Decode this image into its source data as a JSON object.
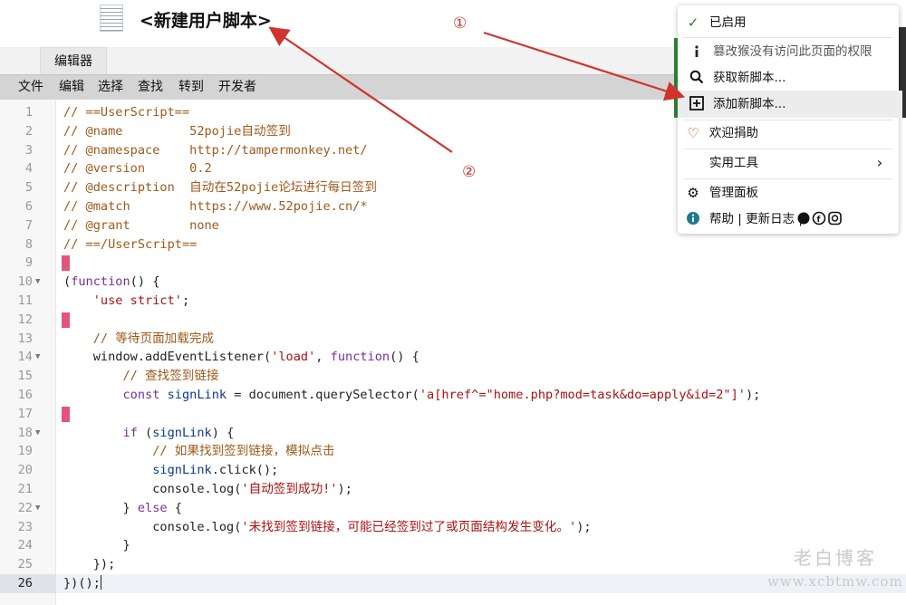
{
  "header": {
    "title": "<新建用户脚本>"
  },
  "tabs": [
    {
      "label": "编辑器"
    }
  ],
  "menu": [
    "文件",
    "编辑",
    "选择",
    "查找",
    "转到",
    "开发者"
  ],
  "editor_lines": [
    {
      "n": "1",
      "tokens": [
        {
          "t": "// ==UserScript==",
          "c": "cm"
        }
      ]
    },
    {
      "n": "2",
      "tokens": [
        {
          "t": "// @name         52pojie自动签到",
          "c": "cm"
        }
      ]
    },
    {
      "n": "3",
      "tokens": [
        {
          "t": "// @namespace    http://tampermonkey.net/",
          "c": "cm"
        }
      ]
    },
    {
      "n": "4",
      "tokens": [
        {
          "t": "// @version      0.2",
          "c": "cm"
        }
      ]
    },
    {
      "n": "5",
      "tokens": [
        {
          "t": "// @description  自动在52pojie论坛进行每日签到",
          "c": "cm"
        }
      ]
    },
    {
      "n": "6",
      "tokens": [
        {
          "t": "// @match        https://www.52pojie.cn/*",
          "c": "cm"
        }
      ]
    },
    {
      "n": "7",
      "tokens": [
        {
          "t": "// @grant        none",
          "c": "cm"
        }
      ]
    },
    {
      "n": "8",
      "tokens": [
        {
          "t": "// ==/UserScript==",
          "c": "cm"
        }
      ]
    },
    {
      "n": "9",
      "marker": true,
      "tokens": []
    },
    {
      "n": "10",
      "fold": true,
      "tokens": [
        {
          "t": "(",
          "c": ""
        },
        {
          "t": "function",
          "c": "kw"
        },
        {
          "t": "() {",
          "c": ""
        }
      ]
    },
    {
      "n": "11",
      "tokens": [
        {
          "t": "    ",
          "c": ""
        },
        {
          "t": "'use strict'",
          "c": "str"
        },
        {
          "t": ";",
          "c": ""
        }
      ]
    },
    {
      "n": "12",
      "marker": true,
      "tokens": []
    },
    {
      "n": "13",
      "tokens": [
        {
          "t": "    // 等待页面加载完成",
          "c": "cm"
        }
      ]
    },
    {
      "n": "14",
      "fold": true,
      "tokens": [
        {
          "t": "    window.addEventListener(",
          "c": ""
        },
        {
          "t": "'load'",
          "c": "str"
        },
        {
          "t": ", ",
          "c": ""
        },
        {
          "t": "function",
          "c": "kw"
        },
        {
          "t": "() {",
          "c": ""
        }
      ]
    },
    {
      "n": "15",
      "tokens": [
        {
          "t": "        // 查找签到链接",
          "c": "cm"
        }
      ]
    },
    {
      "n": "16",
      "tokens": [
        {
          "t": "        ",
          "c": ""
        },
        {
          "t": "const",
          "c": "kw"
        },
        {
          "t": " ",
          "c": ""
        },
        {
          "t": "signLink",
          "c": "var"
        },
        {
          "t": " = document.querySelector(",
          "c": ""
        },
        {
          "t": "'a[href^=\"home.php?mod=task&do=apply&id=2\"]'",
          "c": "str"
        },
        {
          "t": ");",
          "c": ""
        }
      ]
    },
    {
      "n": "17",
      "marker": true,
      "tokens": []
    },
    {
      "n": "18",
      "fold": true,
      "tokens": [
        {
          "t": "        ",
          "c": ""
        },
        {
          "t": "if",
          "c": "kw"
        },
        {
          "t": " (",
          "c": ""
        },
        {
          "t": "signLink",
          "c": "var"
        },
        {
          "t": ") {",
          "c": ""
        }
      ]
    },
    {
      "n": "19",
      "tokens": [
        {
          "t": "            // 如果找到签到链接，模拟点击",
          "c": "cm"
        }
      ]
    },
    {
      "n": "20",
      "tokens": [
        {
          "t": "            ",
          "c": ""
        },
        {
          "t": "signLink",
          "c": "var"
        },
        {
          "t": ".click();",
          "c": ""
        }
      ]
    },
    {
      "n": "21",
      "tokens": [
        {
          "t": "            console.log(",
          "c": ""
        },
        {
          "t": "'自动签到成功!'",
          "c": "str"
        },
        {
          "t": ");",
          "c": ""
        }
      ]
    },
    {
      "n": "22",
      "fold": true,
      "tokens": [
        {
          "t": "        } ",
          "c": ""
        },
        {
          "t": "else",
          "c": "kw"
        },
        {
          "t": " {",
          "c": ""
        }
      ]
    },
    {
      "n": "23",
      "tokens": [
        {
          "t": "            console.log(",
          "c": ""
        },
        {
          "t": "'未找到签到链接，可能已经签到过了或页面结构发生变化。'",
          "c": "str"
        },
        {
          "t": ");",
          "c": ""
        }
      ]
    },
    {
      "n": "24",
      "tokens": [
        {
          "t": "        }",
          "c": ""
        }
      ]
    },
    {
      "n": "25",
      "tokens": [
        {
          "t": "    });",
          "c": ""
        }
      ]
    },
    {
      "n": "26",
      "active": true,
      "tokens": [
        {
          "t": "})();",
          "c": ""
        }
      ]
    }
  ],
  "popup": {
    "enabled": {
      "label": "已启用",
      "icon": "check-icon"
    },
    "permission": {
      "label": "篡改猴没有访问此页面的权限",
      "icon": "info-icon"
    },
    "get_new": {
      "label": "获取新脚本...",
      "icon": "search-icon"
    },
    "add_new": {
      "label": "添加新脚本...",
      "icon": "plus-box-icon"
    },
    "donate": {
      "label": "欢迎捐助",
      "icon": "heart-icon"
    },
    "tools": {
      "label": "实用工具",
      "icon": "chevron-right-icon"
    },
    "dashboard": {
      "label": "管理面板",
      "icon": "gear-icon"
    },
    "help": {
      "label": "帮助 | 更新日志 |",
      "icon": "info-circle-icon"
    }
  },
  "annotations": {
    "one": "①",
    "two": "②",
    "color": "#d0342c"
  },
  "watermark": {
    "name": "老白博客",
    "url": "www.xcbtmw.com"
  }
}
